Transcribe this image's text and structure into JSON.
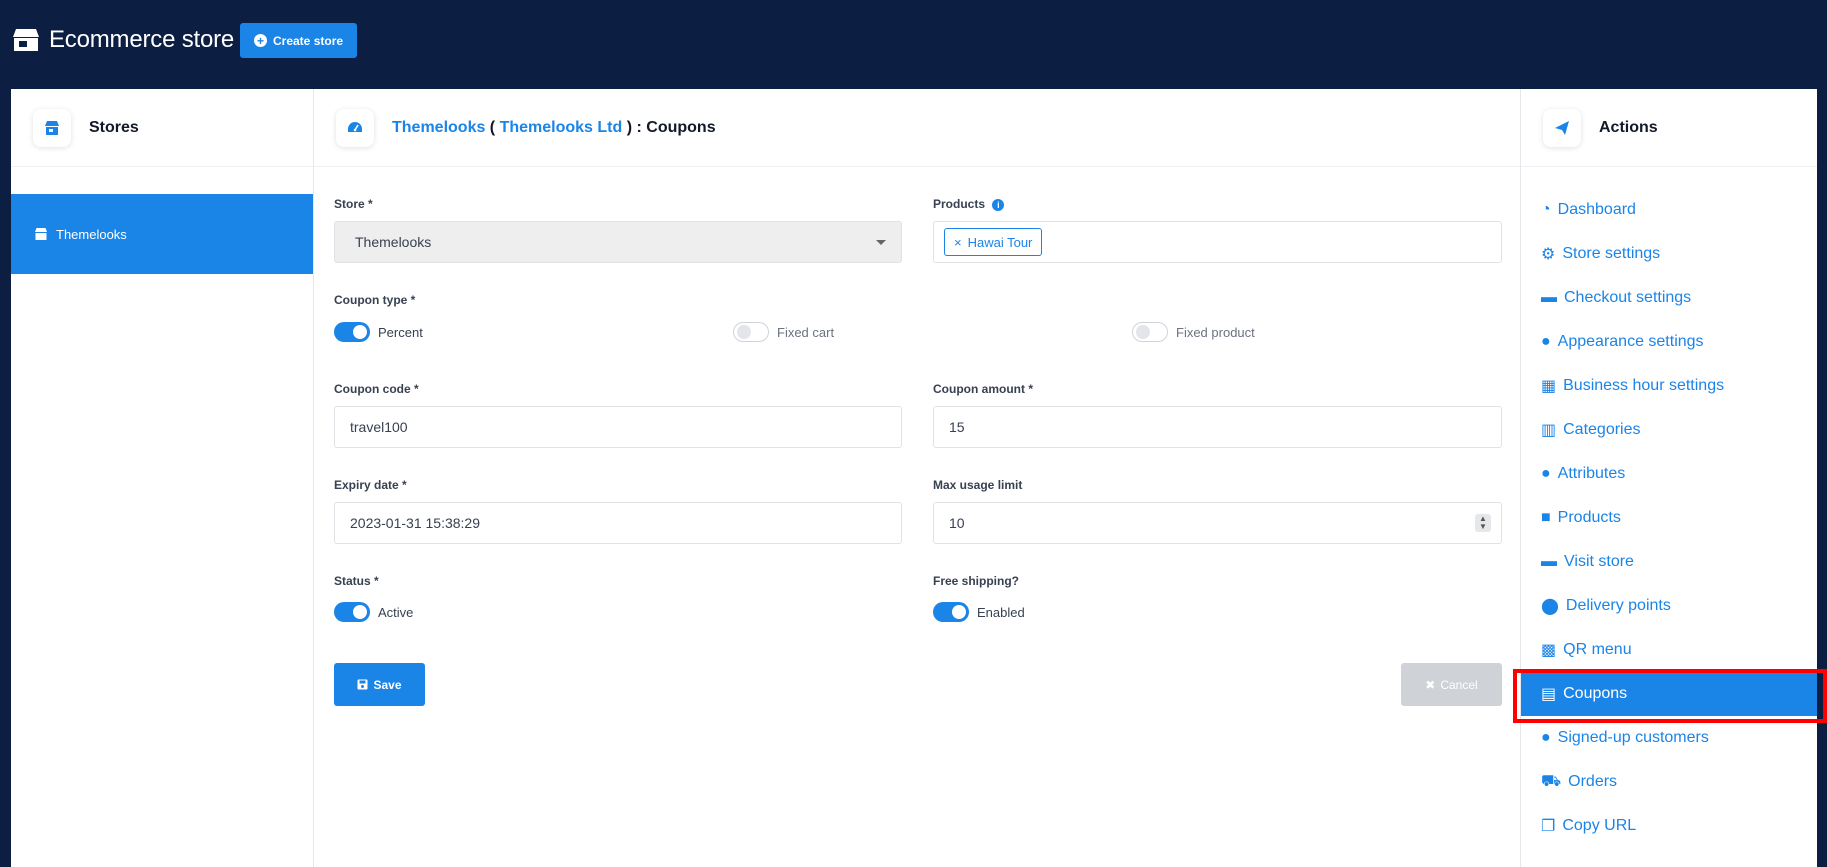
{
  "app": {
    "title": "Ecommerce store",
    "create_button": "Create store"
  },
  "stores_panel": {
    "title": "Stores",
    "items": [
      {
        "label": "Themelooks"
      }
    ]
  },
  "main": {
    "breadcrumb": {
      "store": "Themelooks",
      "open_paren": " ( ",
      "company": "Themelooks Ltd",
      "close_paren": " )",
      "page": " : Coupons"
    }
  },
  "form": {
    "store": {
      "label": "Store *",
      "value": "Themelooks"
    },
    "products": {
      "label": "Products",
      "info_icon": "i",
      "selected": [
        {
          "label": "Hawai Tour",
          "remove_glyph": "×"
        }
      ]
    },
    "coupon_type": {
      "label": "Coupon type *",
      "options": [
        {
          "label": "Percent",
          "checked": true
        },
        {
          "label": "Fixed cart",
          "checked": false
        },
        {
          "label": "Fixed product",
          "checked": false
        }
      ]
    },
    "coupon_code": {
      "label": "Coupon code *",
      "value": "travel100"
    },
    "coupon_amount": {
      "label": "Coupon amount *",
      "value": "15"
    },
    "expiry_date": {
      "label": "Expiry date *",
      "value": "2023-01-31 15:38:29"
    },
    "max_usage": {
      "label": "Max usage limit",
      "value": "10"
    },
    "status": {
      "label": "Status *",
      "toggle_label": "Active",
      "checked": true
    },
    "free_shipping": {
      "label": "Free shipping?",
      "toggle_label": "Enabled",
      "checked": true
    },
    "save_button": "Save",
    "cancel_button": "Cancel"
  },
  "actions": {
    "title": "Actions",
    "items": [
      {
        "label": "Dashboard",
        "icon": "dashboard-icon"
      },
      {
        "label": "Store settings",
        "icon": "gear-icon"
      },
      {
        "label": "Checkout settings",
        "icon": "credit-card-icon"
      },
      {
        "label": "Appearance settings",
        "icon": "palette-icon"
      },
      {
        "label": "Business hour settings",
        "icon": "calendar-icon"
      },
      {
        "label": "Categories",
        "icon": "table-icon"
      },
      {
        "label": "Attributes",
        "icon": "palette-icon"
      },
      {
        "label": "Products",
        "icon": "boxes-icon"
      },
      {
        "label": "Visit store",
        "icon": "credit-card-icon"
      },
      {
        "label": "Delivery points",
        "icon": "map-marker-icon"
      },
      {
        "label": "QR menu",
        "icon": "qrcode-icon"
      },
      {
        "label": "Coupons",
        "icon": "coupon-icon",
        "active": true
      },
      {
        "label": "Signed-up customers",
        "icon": "users-icon"
      },
      {
        "label": "Orders",
        "icon": "cart-icon"
      },
      {
        "label": "Copy URL",
        "icon": "copy-icon"
      }
    ]
  },
  "colors": {
    "topbar": "#0c1e42",
    "accent": "#1b84e7",
    "highlight": "#ff0000"
  }
}
